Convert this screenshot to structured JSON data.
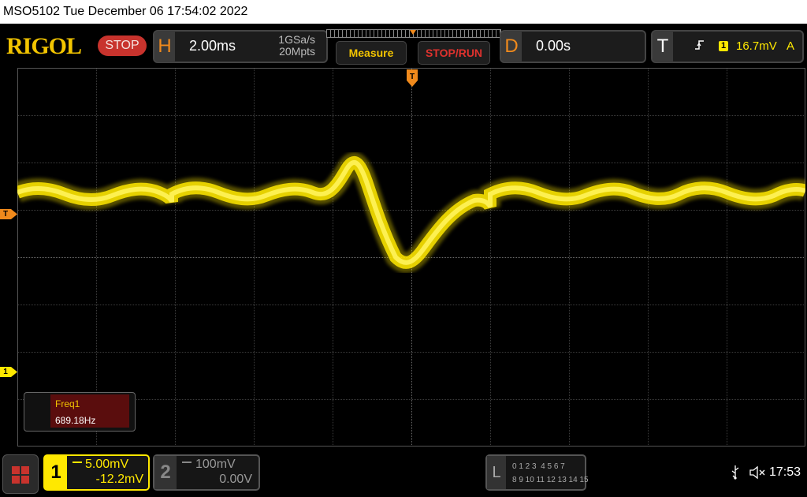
{
  "titlebar": {
    "text": "MSO5102  Tue December 06 17:54:02 2022"
  },
  "brand": {
    "logo": "RIGOL",
    "run_state": "STOP"
  },
  "horizontal": {
    "letter": "H",
    "timebase": "2.00ms",
    "sample_rate": "1GSa/s",
    "memory_depth": "20Mpts"
  },
  "buttons": {
    "measure": "Measure",
    "stop_run": "STOP/RUN"
  },
  "delay": {
    "letter": "D",
    "value": "0.00s"
  },
  "trigger": {
    "letter": "T",
    "slope_icon": "rising-edge-icon",
    "source": "1",
    "level": "16.7mV",
    "mode": "A"
  },
  "markers": {
    "trigger_pos": "T",
    "trigger_level": "T",
    "channel1_ref": "1"
  },
  "measure_box": {
    "name": "Freq1",
    "value": "689.18Hz"
  },
  "channel1": {
    "number": "1",
    "coupling_icon": "dc-coupling-icon",
    "scale": "5.00mV",
    "offset": "-12.2mV",
    "color": "#ffe800"
  },
  "channel2": {
    "number": "2",
    "coupling_icon": "dc-coupling-icon",
    "scale": "100mV",
    "offset": "0.00V"
  },
  "logic": {
    "letter": "L",
    "row1": "0 1 2 3  4 5 6 7",
    "row2": "8 9 10 11 12 13 14 15"
  },
  "status": {
    "usb_icon": "usb-icon",
    "mute_icon": "speaker-muted-icon",
    "time": "17:53"
  },
  "colors": {
    "accent": "#f08a1c",
    "trace": "#ffe800",
    "stop": "#c8332d",
    "brand": "#f2c400"
  }
}
